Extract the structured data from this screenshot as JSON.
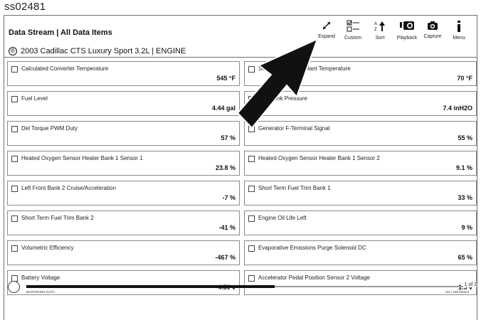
{
  "caption": "ss02481",
  "header": {
    "title": "Data Stream | All Data Items",
    "vehicle": "2003 Cadillac CTS Luxury Sport 3.2L | ENGINE",
    "copyright_symbol": "©"
  },
  "toolbar": {
    "expand": "Expand",
    "custom": "Custom",
    "sort": "Sort",
    "playback": "Playback",
    "capture": "Capture",
    "menu": "Menu"
  },
  "items": [
    {
      "name": "Calculated Converter Temperature",
      "value": "545 °F"
    },
    {
      "name": "Startup Engine Coolant Temperature",
      "value": "70 °F"
    },
    {
      "name": "Fuel Level",
      "value": "4.44 gal"
    },
    {
      "name": "Fuel Tank Pressure",
      "value": "7.4 inH2O"
    },
    {
      "name": "Del Torque PWM Duty",
      "value": "57 %"
    },
    {
      "name": "Generator F-Terminal Signal",
      "value": "55 %"
    },
    {
      "name": "Heated Oxygen Sensor Heater Bank 1 Sensor 1",
      "value": "23.8 %"
    },
    {
      "name": "Heated Oxygen Sensor Heater Bank 1 Sensor 2",
      "value": "9.1 %"
    },
    {
      "name": "Left Front Bank 2 Cruise/Acceleration",
      "value": "-7 %"
    },
    {
      "name": "Short Term Fuel Trim Bank 1",
      "value": "33 %"
    },
    {
      "name": "Short Term Fuel Trim Bank 2",
      "value": "-41 %"
    },
    {
      "name": "Engine Oil Life Left",
      "value": "9 %"
    },
    {
      "name": "Volumetric Efficiency",
      "value": "-467 %"
    },
    {
      "name": "Evaporative Emissions Purge Solenoid DC",
      "value": "65 %"
    },
    {
      "name": "Battery Voltage",
      "value": "4.50 v"
    },
    {
      "name": "Accelerator Pedal Position Sensor 2 Voltage",
      "value": "1.5 v"
    }
  ],
  "player": {
    "status": "BUFFERING DATA.",
    "frames": "112 / 200 frames",
    "page": "1 of 2",
    "progress": 0.56
  },
  "colors": {
    "border": "#8a8a8a",
    "text": "#222222",
    "arrow": "#111111"
  }
}
